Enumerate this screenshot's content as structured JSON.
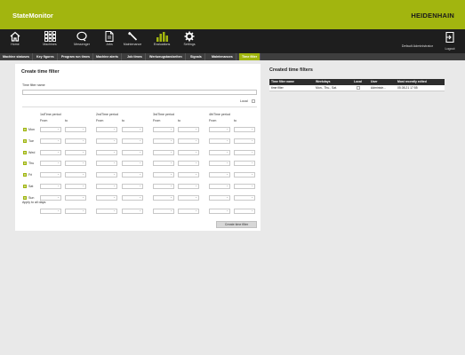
{
  "app": {
    "title": "StateMonitor",
    "brand": "HEIDENHAIN"
  },
  "toolbar": {
    "items": [
      {
        "label": "Home",
        "icon": "home-icon"
      },
      {
        "label": "Machines",
        "icon": "grid-icon"
      },
      {
        "label": "Messenger",
        "icon": "chat-bubble-icon"
      },
      {
        "label": "Jobs",
        "icon": "document-icon"
      },
      {
        "label": "Maintenance",
        "icon": "wrench-icon"
      },
      {
        "label": "Evaluations",
        "icon": "bar-chart-icon"
      },
      {
        "label": "Settings",
        "icon": "gear-icon"
      }
    ],
    "user": "Default Administrator",
    "logout": "Logout"
  },
  "tabs": [
    "Machine statuses",
    "Key figures",
    "Program run times",
    "Machine alerts",
    "Job times",
    "Werkzeugstandzeiten",
    "Signals",
    "Maintenances",
    "Time filter"
  ],
  "active_tab": "Time filter",
  "create": {
    "title": "Create time filter",
    "name_label": "Time filter name",
    "name_value": "",
    "local_label": "Local",
    "periods": [
      "1stTime period",
      "2ndTime period",
      "3rdTime period",
      "4thTime period"
    ],
    "from_label": "From",
    "to_label": "to",
    "days": [
      {
        "label": "Mon",
        "checked": true
      },
      {
        "label": "Tue",
        "checked": true
      },
      {
        "label": "Wed",
        "checked": true
      },
      {
        "label": "Thu",
        "checked": true
      },
      {
        "label": "Fri",
        "checked": true
      },
      {
        "label": "Sat",
        "checked": true
      },
      {
        "label": "Sun",
        "checked": true
      }
    ],
    "apply_all_label": "Apply to all days:",
    "button": "Create time filter"
  },
  "created": {
    "title": "Created time filters",
    "columns": [
      "Time filter name",
      "Weekdays",
      "Local",
      "User",
      "Most recently edited"
    ],
    "rows": [
      {
        "name": "time filter",
        "weekdays": "Mon., Thu., Sat.",
        "local": false,
        "user": "Administr...",
        "edited": "05.08.21 17:55"
      }
    ]
  }
}
